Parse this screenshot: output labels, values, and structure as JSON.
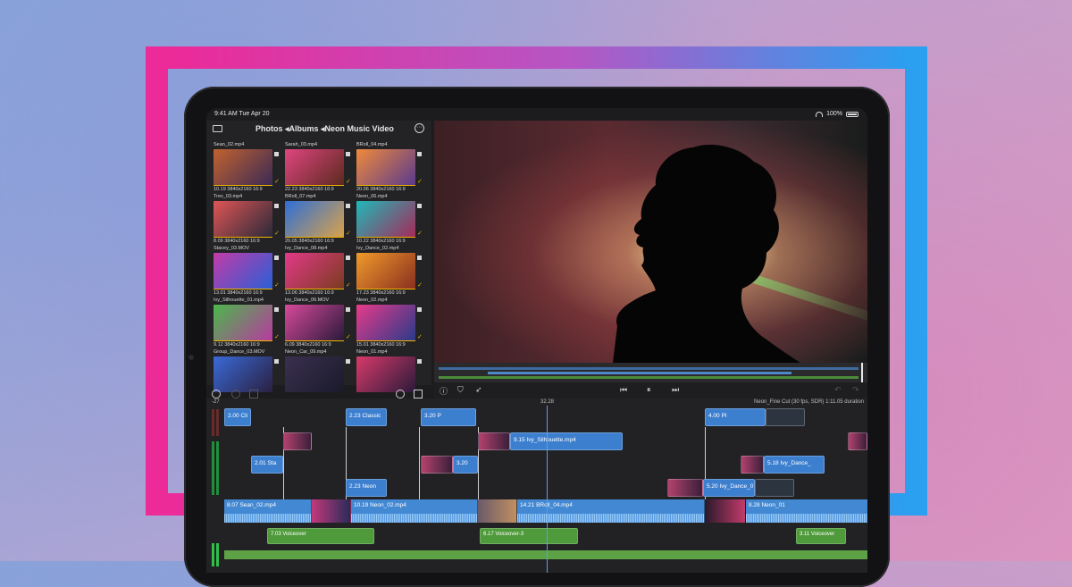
{
  "status": {
    "time": "9:41 AM  Tue Apr 20",
    "battery": "100%"
  },
  "browser": {
    "breadcrumb": "Photos ◂Albums ◂Neon Music Video",
    "clips": [
      {
        "name": "Sean_02.mp4",
        "meta": "10.19  3840x2160  16:9",
        "color1": "#c2622f",
        "color2": "#3b2a55"
      },
      {
        "name": "Sarah_03.mp4",
        "meta": "22.23  3840x2160  16:9",
        "color1": "#e0457f",
        "color2": "#5b2a1f"
      },
      {
        "name": "BRoll_04.mp4",
        "meta": "20.06  3840x2160  16:9",
        "color1": "#f08a3c",
        "color2": "#5a3a8c"
      },
      {
        "name": "Trev_03.mp4",
        "meta": "8.09  3840x2160  16:9",
        "color1": "#e05555",
        "color2": "#2a2a3a"
      },
      {
        "name": "BRoll_07.mp4",
        "meta": "20.05  3840x2160  16:9",
        "color1": "#2e6fd6",
        "color2": "#d9a24b"
      },
      {
        "name": "Neon_06.mp4",
        "meta": "10.22  3840x2160  16:9",
        "color1": "#1fb8b8",
        "color2": "#a52a5a"
      },
      {
        "name": "Stacey_03.MOV",
        "meta": "13.01  3840x2160  16:9",
        "color1": "#c33ba8",
        "color2": "#2a5fd6"
      },
      {
        "name": "Ivy_Dance_08.mp4",
        "meta": "13.06  3840x2160  16:9",
        "color1": "#e33a88",
        "color2": "#7a3b1f"
      },
      {
        "name": "Ivy_Dance_02.mp4",
        "meta": "17.23  3840x2160  16:9",
        "color1": "#f09a2a",
        "color2": "#8a3020"
      },
      {
        "name": "Ivy_Silhouette_01.mp4",
        "meta": "9.12  3840x2160  16:9",
        "color1": "#4ab84a",
        "color2": "#b83aa0"
      },
      {
        "name": "Ivy_Dance_06.MOV",
        "meta": "6.09  3840x2160  16:9",
        "color1": "#d84a9a",
        "color2": "#2a1a3a"
      },
      {
        "name": "Neon_02.mp4",
        "meta": "15.01  3840x2160  16:9",
        "color1": "#e83a8a",
        "color2": "#2a3a8a"
      },
      {
        "name": "Group_Dance_03.MOV",
        "meta": "",
        "color1": "#3a6ad8",
        "color2": "#2a2040"
      },
      {
        "name": "Neon_Car_09.mp4",
        "meta": "",
        "color1": "#3a3050",
        "color2": "#1a1a2a"
      },
      {
        "name": "Neon_01.mp4",
        "meta": "",
        "color1": "#d83a6a",
        "color2": "#2a1a3a"
      }
    ]
  },
  "timeline": {
    "ruler_left": "-27",
    "ruler_mark": "32.28",
    "project_info": "Neon_Fine Cut (30 fps, SDR)  1:11.05 duration",
    "upper_clips": [
      {
        "label": "2.00  Cli"
      },
      {
        "label": "2.23  Classic"
      },
      {
        "label": "3.20  P"
      },
      {
        "label": "4.00  Pl"
      },
      {
        "label": "2.01  Sta"
      },
      {
        "label": "9.15  Ivy_Silhouette.mp4"
      },
      {
        "label": "3.20"
      },
      {
        "label": "5.18  Ivy_Dance_"
      },
      {
        "label": "2.23  Neon"
      },
      {
        "label": "5.20  Ivy_Dance_0"
      }
    ],
    "primary": [
      {
        "label": "8.07  Sean_02.mp4"
      },
      {
        "label": "10.19  Neon_02.mp4"
      },
      {
        "label": "14.21  BRoll_04.mp4"
      },
      {
        "label": "8.28  Neon_01"
      }
    ],
    "audio": [
      {
        "label": "7.03  Voiceover"
      },
      {
        "label": "6.17  Voiceover-3"
      },
      {
        "label": "3.11  Voiceover"
      }
    ]
  }
}
